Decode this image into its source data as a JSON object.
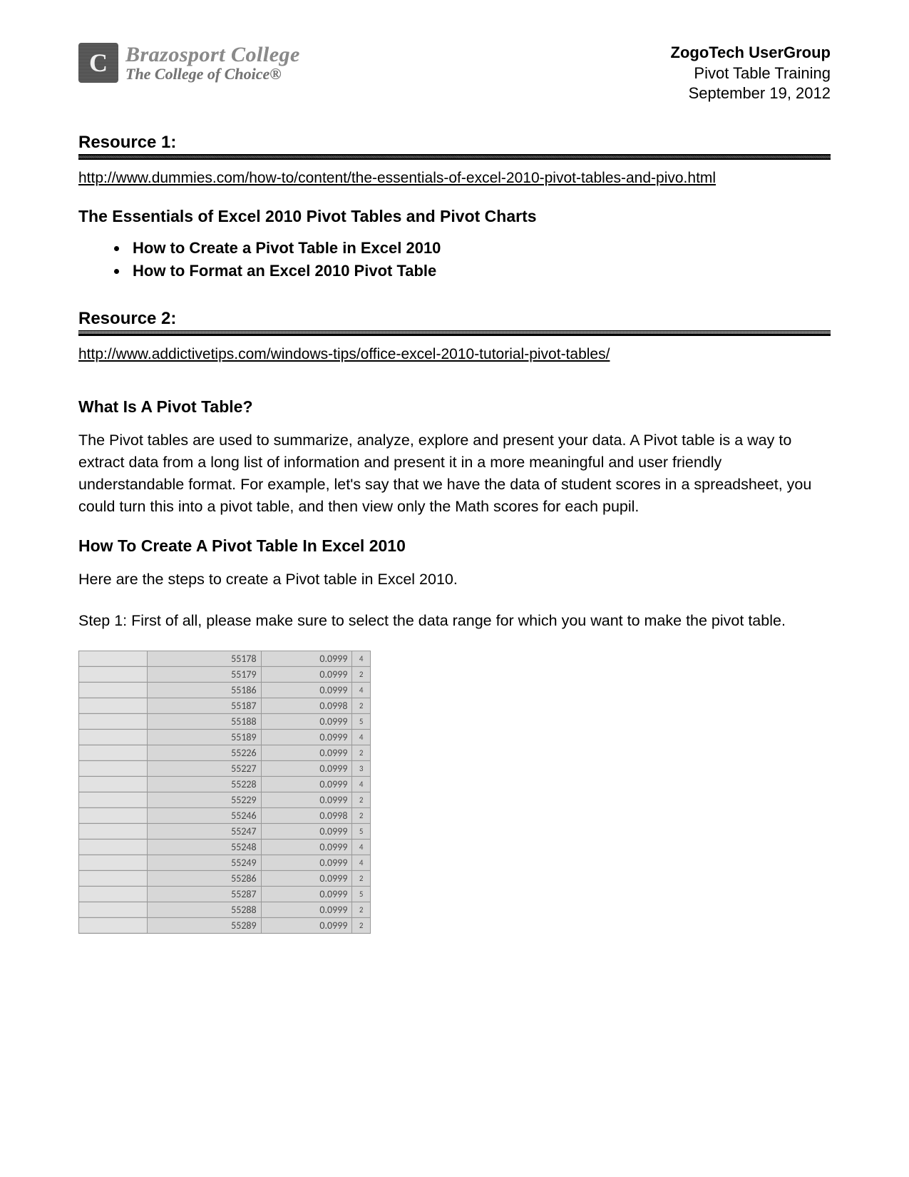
{
  "header": {
    "logo": {
      "line1": "Brazosport College",
      "line2": "The College of Choice®"
    },
    "right": {
      "title": "ZogoTech UserGroup",
      "subtitle": "Pivot Table Training",
      "date": "September 19, 2012"
    }
  },
  "resource1": {
    "label": "Resource 1:",
    "link": "http://www.dummies.com/how-to/content/the-essentials-of-excel-2010-pivot-tables-and-pivo.html",
    "heading": "The Essentials of Excel 2010 Pivot Tables and Pivot Charts",
    "bullets": [
      "How to Create a Pivot Table in Excel 2010",
      "How to Format an Excel 2010 Pivot Table"
    ]
  },
  "resource2": {
    "label": "Resource 2:",
    "link": "http://www.addictivetips.com/windows-tips/office-excel-2010-tutorial-pivot-tables/",
    "h1": "What Is A Pivot Table?",
    "p1": "The Pivot tables are used to summarize, analyze, explore and present your data. A Pivot table is a way to extract data from a long list of information and present it in a more meaningful and user friendly understandable format. For example, let's say that we have the data of student scores in a spreadsheet, you could turn this into a pivot table, and then view only the Math scores for each pupil.",
    "h2": "How To Create A Pivot Table In Excel 2010",
    "p2": "Here are the steps to create a Pivot table in Excel 2010.",
    "step1": "Step 1: First of all, please make sure to select the data range for which you want to make the pivot table."
  },
  "spreadsheet": {
    "rows": [
      {
        "a": "",
        "b": "55178",
        "c": "0.0999",
        "d": "4"
      },
      {
        "a": "",
        "b": "55179",
        "c": "0.0999",
        "d": "2"
      },
      {
        "a": "",
        "b": "55186",
        "c": "0.0999",
        "d": "4"
      },
      {
        "a": "",
        "b": "55187",
        "c": "0.0998",
        "d": "2"
      },
      {
        "a": "",
        "b": "55188",
        "c": "0.0999",
        "d": "5"
      },
      {
        "a": "",
        "b": "55189",
        "c": "0.0999",
        "d": "4"
      },
      {
        "a": "",
        "b": "55226",
        "c": "0.0999",
        "d": "2"
      },
      {
        "a": "",
        "b": "55227",
        "c": "0.0999",
        "d": "3"
      },
      {
        "a": "",
        "b": "55228",
        "c": "0.0999",
        "d": "4"
      },
      {
        "a": "",
        "b": "55229",
        "c": "0.0999",
        "d": "2"
      },
      {
        "a": "",
        "b": "55246",
        "c": "0.0998",
        "d": "2"
      },
      {
        "a": "",
        "b": "55247",
        "c": "0.0999",
        "d": "5"
      },
      {
        "a": "",
        "b": "55248",
        "c": "0.0999",
        "d": "4"
      },
      {
        "a": "",
        "b": "55249",
        "c": "0.0999",
        "d": "4"
      },
      {
        "a": "",
        "b": "55286",
        "c": "0.0999",
        "d": "2"
      },
      {
        "a": "",
        "b": "55287",
        "c": "0.0999",
        "d": "5"
      },
      {
        "a": "",
        "b": "55288",
        "c": "0.0999",
        "d": "2"
      },
      {
        "a": "",
        "b": "55289",
        "c": "0.0999",
        "d": "2"
      }
    ]
  }
}
